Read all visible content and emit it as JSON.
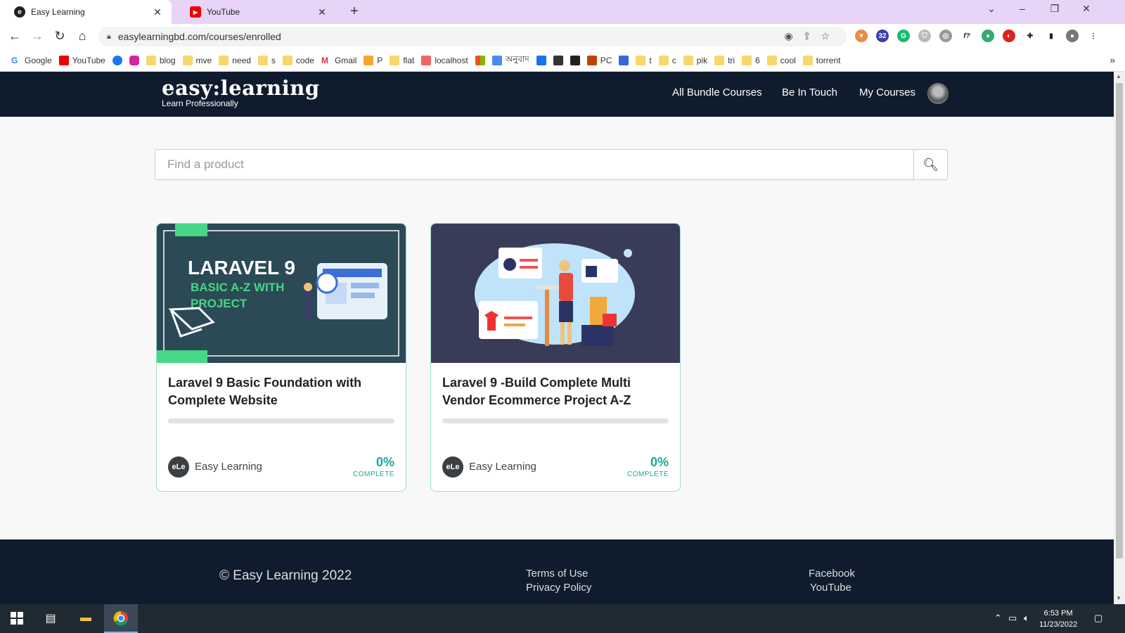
{
  "browser": {
    "tabs": [
      {
        "title": "Easy Learning",
        "favicon": "easy-learning-icon"
      },
      {
        "title": "YouTube",
        "favicon": "youtube-icon"
      }
    ],
    "new_tab": "+",
    "url": "easylearningbd.com/courses/enrolled",
    "extension_badge": "32",
    "bookmarks": [
      "Google",
      "YouTube",
      "",
      "",
      "blog",
      "mve",
      "need",
      "s",
      "code",
      "Gmail",
      "P",
      "flat",
      "localhost",
      "",
      "অনুবাদ",
      "",
      "",
      "",
      "PC",
      "",
      "t",
      "c",
      "pik",
      "tri",
      "6",
      "cool",
      "torrent"
    ],
    "bookmarks_more": "»"
  },
  "site": {
    "logo": "easy:learning",
    "tagline": "Learn Professionally",
    "nav": [
      "All Bundle Courses",
      "Be In Touch",
      "My Courses"
    ],
    "search_placeholder": "Find a product"
  },
  "courses": [
    {
      "title": "Laravel 9 Basic Foundation with Complete Website",
      "thumb_line1": "LARAVEL 9",
      "thumb_line2": "BASIC A-Z WITH",
      "thumb_line3": "PROJECT",
      "author_logo": "eLe",
      "author": "Easy Learning",
      "progress_percent": 0,
      "progress": "0%",
      "progress_label": "COMPLETE"
    },
    {
      "title": "Laravel 9 -Build Complete Multi Vendor Ecommerce Project A-Z",
      "author_logo": "eLe",
      "author": "Easy Learning",
      "progress_percent": 0,
      "progress": "0%",
      "progress_label": "COMPLETE"
    }
  ],
  "footer": {
    "copyright": "© Easy Learning 2022",
    "links": [
      "Terms of Use",
      "Privacy Policy"
    ],
    "social": [
      "Facebook",
      "YouTube"
    ]
  },
  "taskbar": {
    "time": "6:53 PM",
    "date": "11/23/2022"
  },
  "colors": {
    "navbar": "#0f1c2d",
    "accent": "#18a999",
    "tab_strip": "#e7d4f7"
  }
}
